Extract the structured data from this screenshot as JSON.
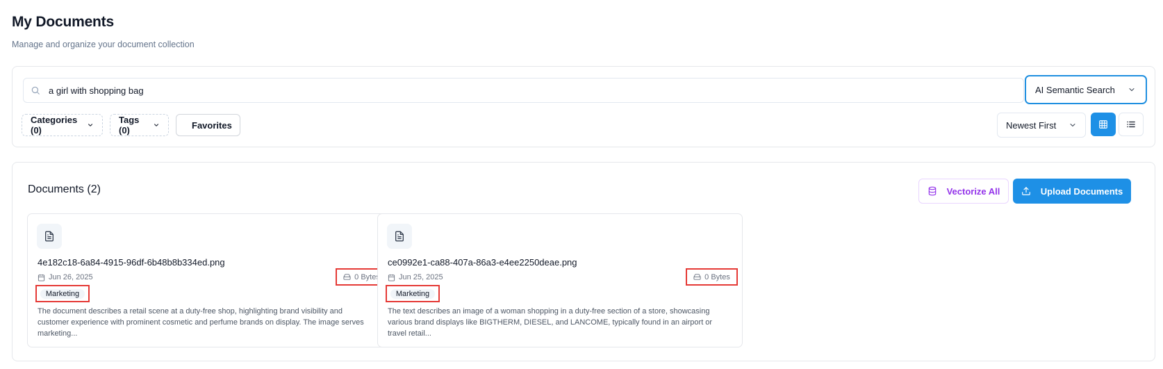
{
  "header": {
    "title": "My Documents",
    "subtitle": "Manage and organize your document collection"
  },
  "search": {
    "value": "a girl with shopping bag",
    "mode": "AI Semantic Search"
  },
  "filters": {
    "categories_label": "Categories (0)",
    "tags_label": "Tags (0)",
    "favorites_label": "Favorites",
    "sort_label": "Newest First",
    "view_mode": "grid"
  },
  "documents": {
    "title": "Documents (2)",
    "vectorize_label": "Vectorize All",
    "upload_label": "Upload Documents",
    "items": [
      {
        "name": "4e182c18-6a84-4915-96df-6b48b8b334ed.png",
        "date": "Jun 26, 2025",
        "size": "0 Bytes",
        "tag": "Marketing",
        "description": "The document describes a retail scene at a duty-free shop, highlighting brand visibility and customer experience with prominent cosmetic and perfume brands on display. The image serves marketing..."
      },
      {
        "name": "ce0992e1-ca88-407a-86a3-e4ee2250deae.png",
        "date": "Jun 25, 2025",
        "size": "0 Bytes",
        "tag": "Marketing",
        "description": "The text describes an image of a woman shopping in a duty-free section of a store, showcasing various brand displays like BIGTHERM, DIESEL, and LANCOME, typically found in an airport or travel retail..."
      }
    ]
  },
  "colors": {
    "primary": "#1e90e6",
    "vectorize": "#9333ea",
    "highlight": "#e53935"
  }
}
